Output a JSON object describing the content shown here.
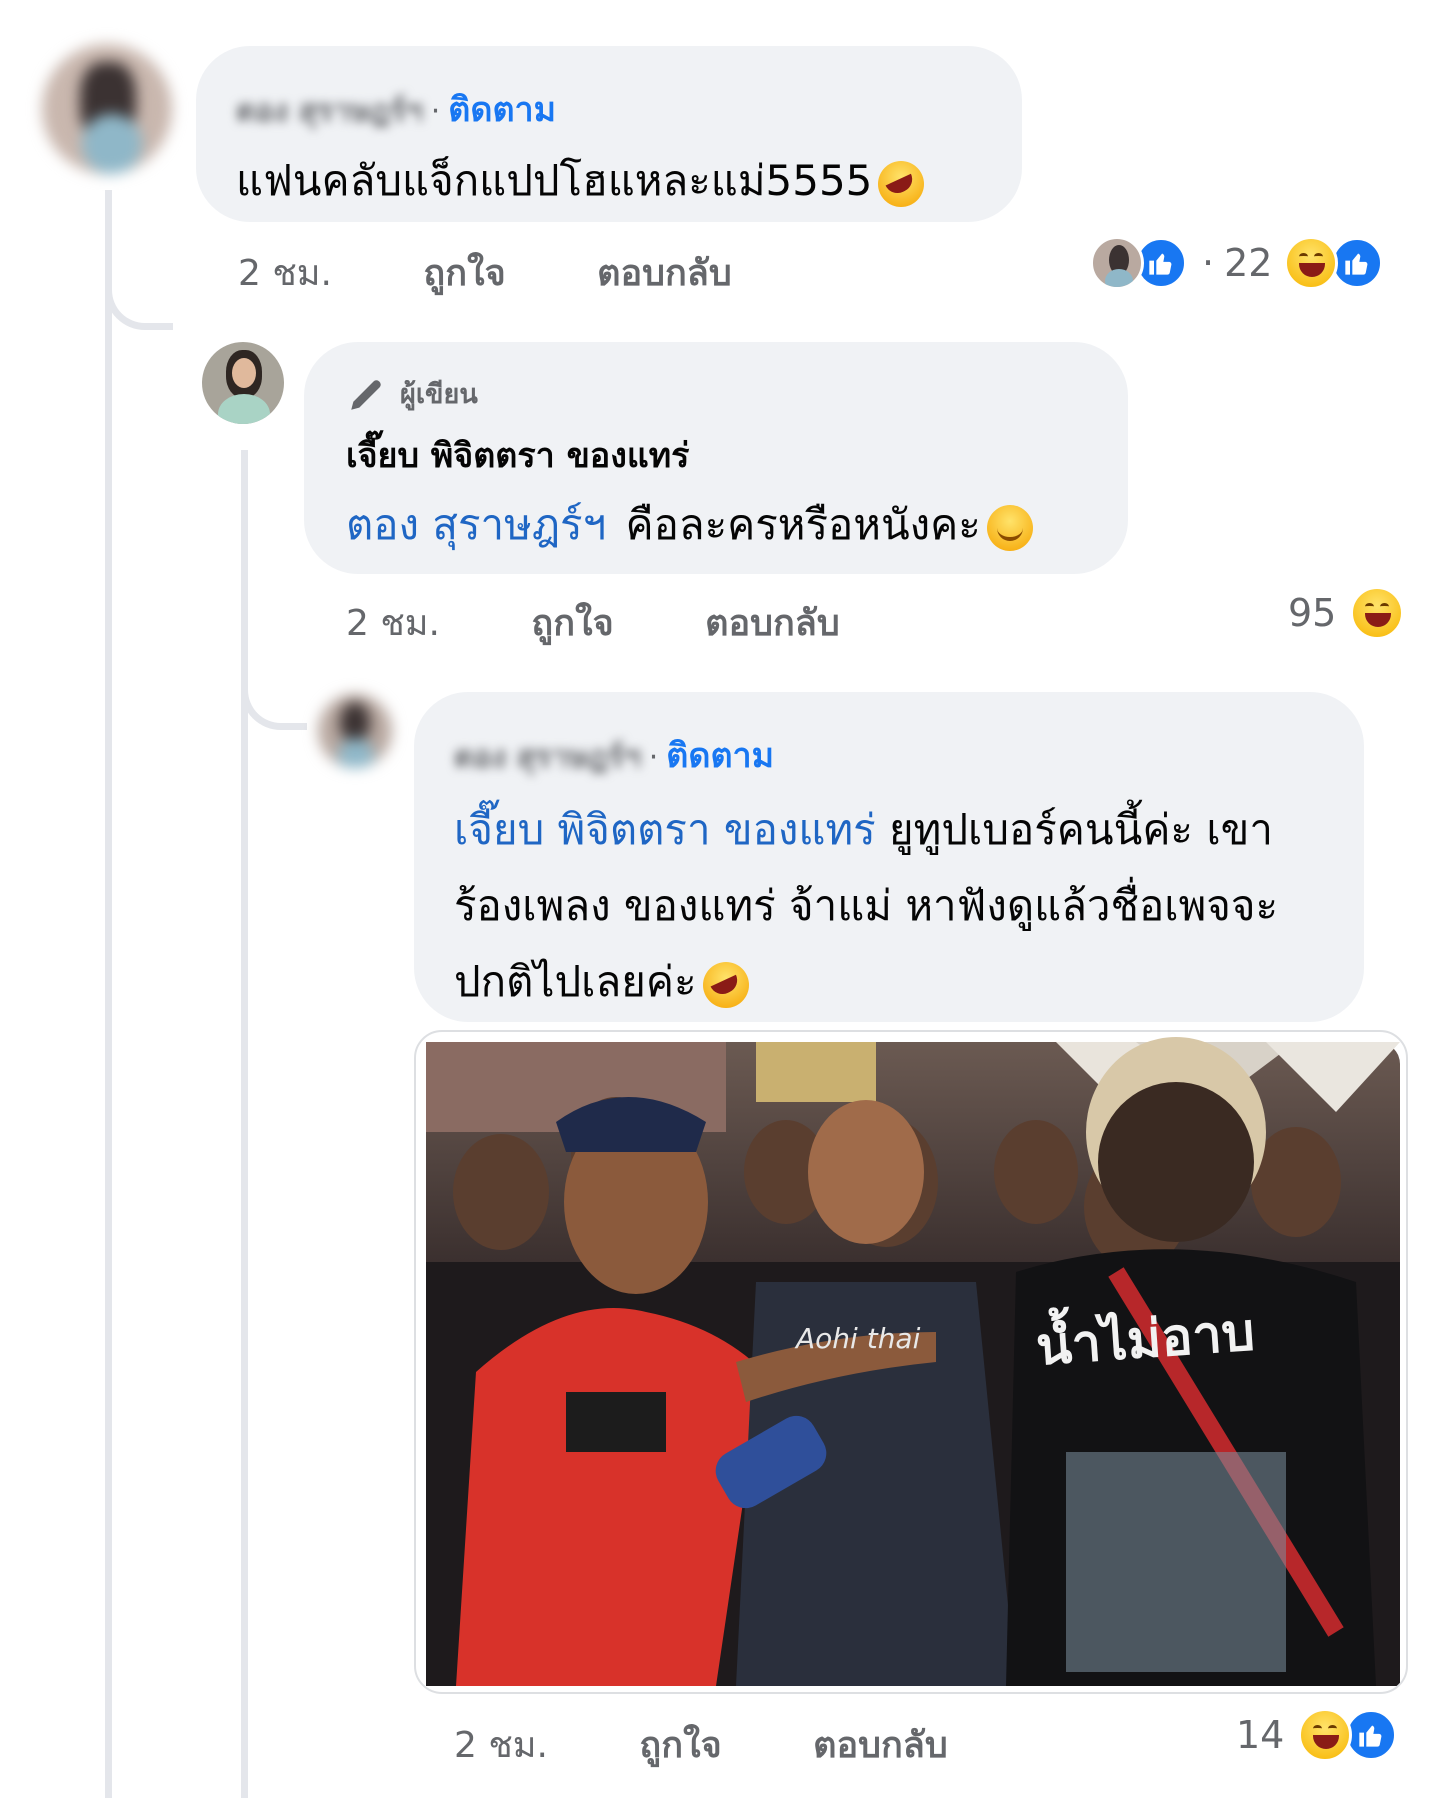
{
  "comments": [
    {
      "author_blurred": "ตอง สุราษฎร์ฯ",
      "follow": "ติดตาม",
      "text": "แฟนคลับแจ็กแปปโฮแหละแม่5555",
      "time": "2 ชม.",
      "like": "ถูกใจ",
      "reply": "ตอบกลับ",
      "reaction_sep": "·",
      "reaction_count": "22"
    },
    {
      "badge": "ผู้เขียน",
      "author": "เจี๊ยบ พิจิตตรา ของแทร่",
      "mention": "ตอง สุราษฎร์ฯ",
      "text": "คือละครหรือหนังคะ",
      "time": "2 ชม.",
      "like": "ถูกใจ",
      "reply": "ตอบกลับ",
      "reaction_count": "95"
    },
    {
      "author_blurred": "ตอง สุราษฎร์ฯ",
      "follow": "ติดตาม",
      "mention": "เจี๊ยบ พิจิตตรา ของแทร่",
      "text_line1": "ยูทูปเบอร์คนนี้ค่ะ เขา",
      "text_line2": "ร้องเพลง ของแทร่ จ้าแม่ หาฟังดูแล้วชื่อเพจจะ",
      "text_line3": "ปกติไปเลยค่ะ",
      "photo_shirt_text": "น้ำไม่อาบ",
      "photo_vest_text": "Aohi thai",
      "time": "2 ชม.",
      "like": "ถูกใจ",
      "reply": "ตอบกลับ",
      "reaction_count": "14"
    }
  ],
  "colors": {
    "bubble": "#f0f2f5",
    "link": "#1f66c4",
    "meta": "#65676b",
    "like_blue": "#1877f2"
  },
  "icons": [
    "thumbs-up-icon",
    "haha-icon",
    "pen-icon",
    "smile-emoji",
    "rofl-emoji"
  ]
}
